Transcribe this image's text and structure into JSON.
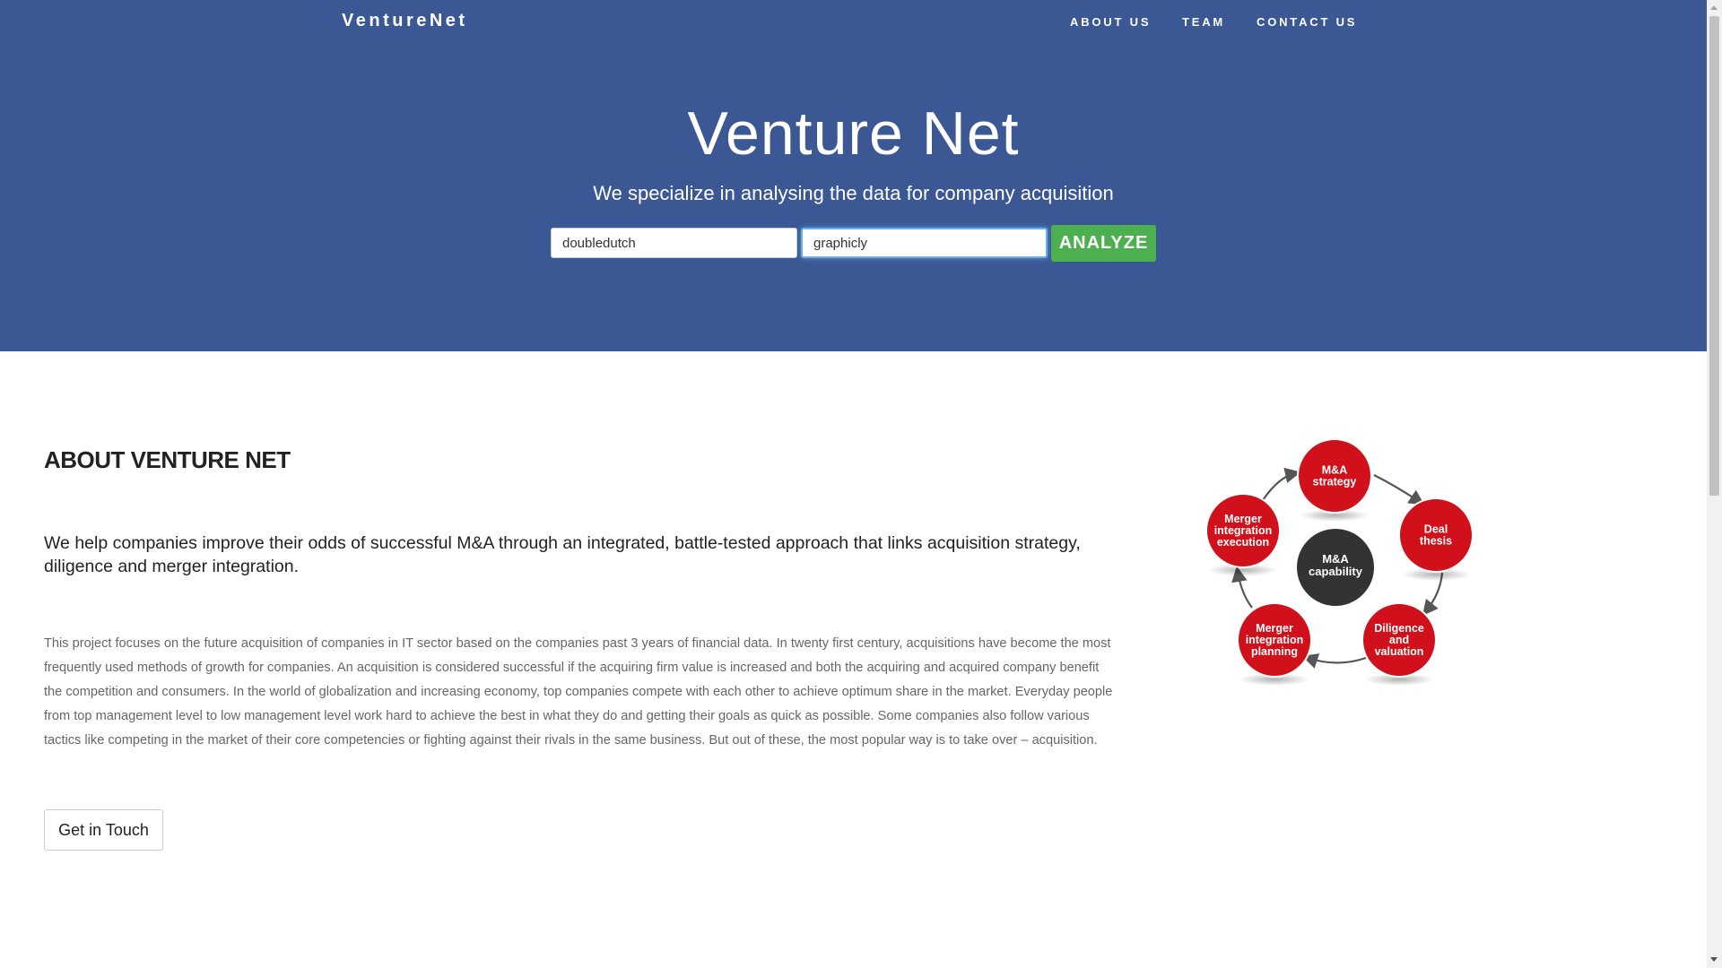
{
  "nav": {
    "brand": "VentureNet",
    "links": [
      "ABOUT US",
      "TEAM",
      "CONTACT US"
    ]
  },
  "hero": {
    "title": "Venture Net",
    "subtitle": "We specialize in analysing the data for company acquisition",
    "company_a_value": "doubledutch",
    "company_b_value": "graphicly",
    "analyze_label": "ANALYZE"
  },
  "about": {
    "title": "ABOUT VENTURE NET",
    "lead": "We help companies improve their odds of successful M&A through an integrated, battle-tested approach that links acquisition strategy, diligence and merger integration.",
    "body": "This project focuses on the future acquisition of companies in IT sector based on the companies past 3 years of financial data. In twenty first century, acquisitions have become the most frequently used methods of growth for companies. An acquisition is considered successful if the acquiring firm value is increased and both the acquiring and acquired company benefit the competition and consumers. In the world of globalization and increasing economy, top companies compete with each other to achieve optimum share in the market. Everyday people from top management level to low management level work hard to achieve the best in what they do and getting their goals as quick as possible. Some companies also follow various tactics like competing in the market of their core competencies or fighting against their rivals in the same business. But out of these, the most popular way is to take over – acquisition.",
    "cta_label": "Get in Touch"
  },
  "diagram": {
    "center_lines": [
      "M&A",
      "capability"
    ],
    "steps": [
      {
        "lines": [
          "M&A",
          "strategy"
        ]
      },
      {
        "lines": [
          "Deal",
          "thesis"
        ]
      },
      {
        "lines": [
          "Diligence",
          "and",
          "valuation"
        ]
      },
      {
        "lines": [
          "Merger",
          "integration",
          "planning"
        ]
      },
      {
        "lines": [
          "Merger",
          "integration",
          "execution"
        ]
      }
    ],
    "colors": {
      "step": "#d0111b",
      "step_ring": "#ffffff",
      "center": "#333333",
      "arrow": "#555555",
      "text": "#ffffff"
    }
  },
  "colors": {
    "hero_bg": "#3b5895",
    "analyze_bg": "#4caf50",
    "heading": "#222222",
    "body_text": "#666666"
  }
}
